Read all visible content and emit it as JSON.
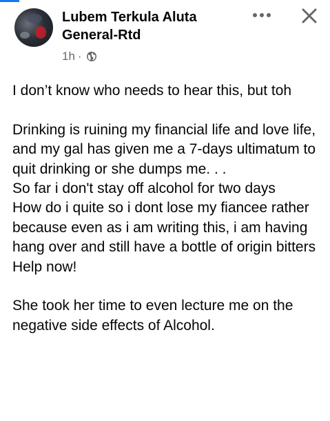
{
  "post": {
    "author": "Lubem Terkula Aluta General-Rtd",
    "time": "1h",
    "separator": "·",
    "icons": {
      "avatar": "profile-photo",
      "audience": "globe-icon",
      "more": "more-horizontal-icon",
      "close": "close-icon"
    },
    "colors": {
      "meta": "#65676b",
      "text": "#050505",
      "accent": "#1877f2"
    },
    "paragraphs": [
      "I don’t know who needs to hear this, but toh",
      "",
      "Drinking is ruining my financial life and love life, and my gal has given me a 7-days ultimatum to quit drinking or she dumps me. . .",
      "So far i don't stay off alcohol for two days",
      "How do i quite so i dont lose my fiancee rather because even as i am writing this, i am having hang over and still have a bottle of origin bitters",
      "Help now!",
      "",
      "She took her time to even lecture me on the negative side effects of Alcohol."
    ]
  }
}
